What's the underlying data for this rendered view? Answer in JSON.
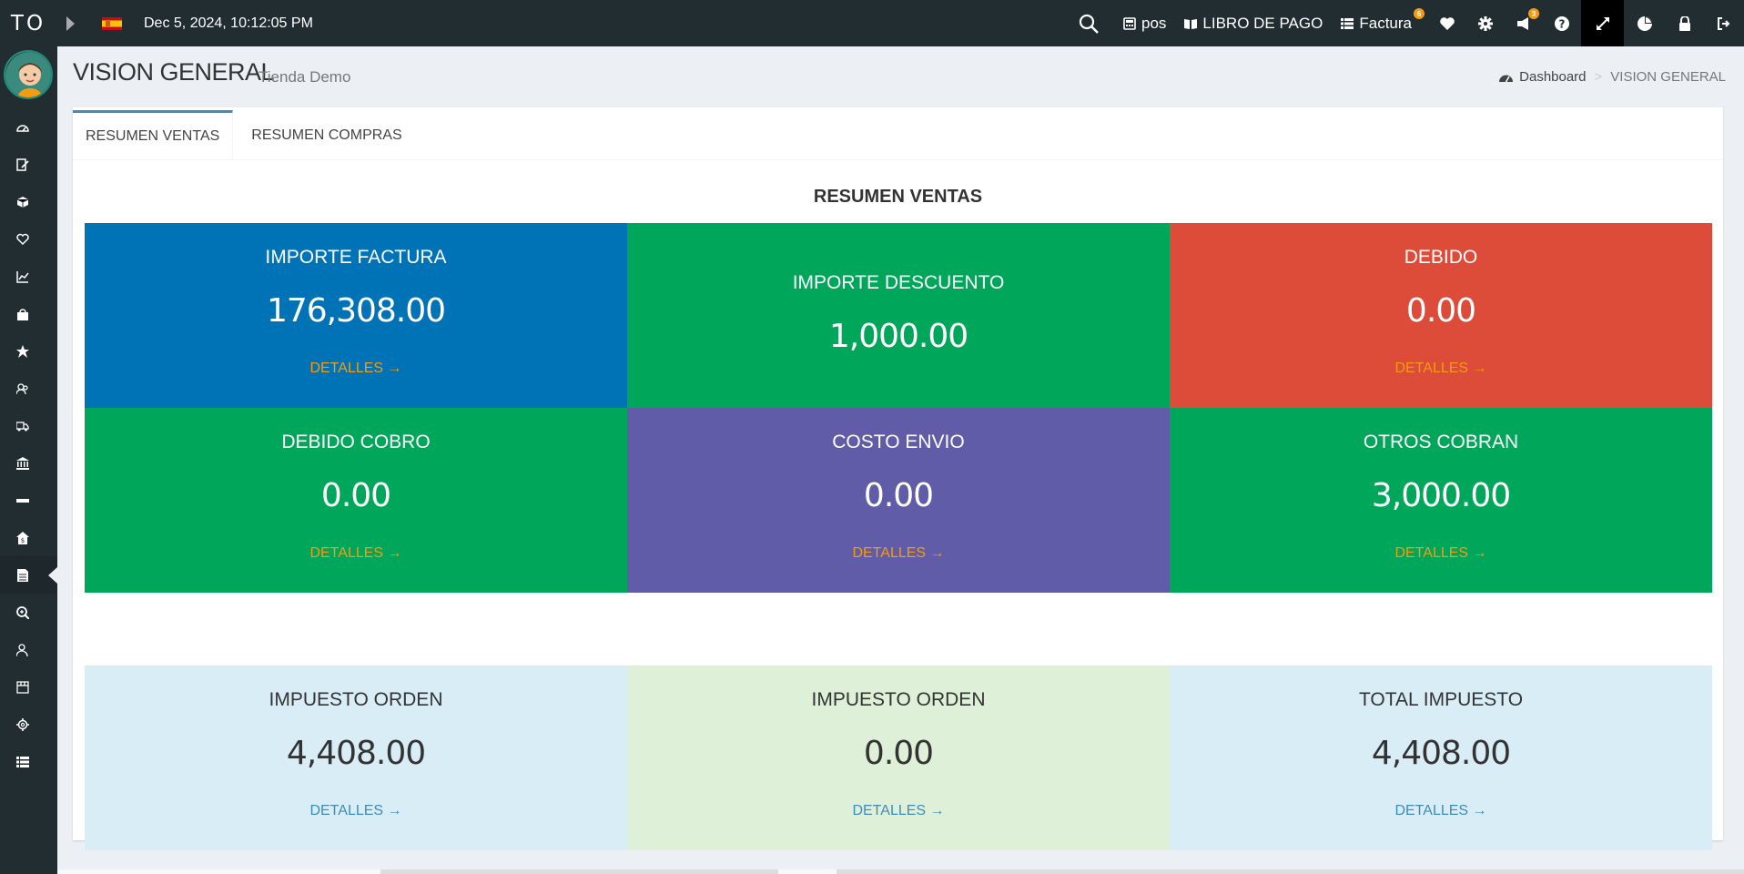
{
  "topbar": {
    "logo": "TO",
    "datetime": "Dec 5, 2024, 10:12:05 PM",
    "pos_label": "pos",
    "libro_label": "LIBRO DE PAGO",
    "factura_label": "Factura",
    "factura_badge": "6",
    "notif_badge": "3",
    "flag_color": "#c60b1e"
  },
  "sidebar": {
    "icons": [
      "dashboard-icon",
      "edit-icon",
      "cube-icon",
      "heart-icon",
      "chart-line-icon",
      "shopping-bag-icon",
      "star-icon",
      "group-icon",
      "truck-icon",
      "bank-icon",
      "minus-icon",
      "home-money-icon",
      "file-text-icon",
      "search-plus-icon",
      "user-icon",
      "tag-icon",
      "gear-icon",
      "list-icon"
    ],
    "active_index": 12
  },
  "header": {
    "title": "VISION GENERAL",
    "subtitle": "Tienda Demo",
    "breadcrumb_home": "Dashboard",
    "breadcrumb_sep": ">",
    "breadcrumb_current": "VISION GENERAL"
  },
  "tabs": [
    {
      "label": "RESUMEN VENTAS"
    },
    {
      "label": "RESUMEN COMPRAS"
    }
  ],
  "section_title": "RESUMEN VENTAS",
  "boxes": [
    {
      "title": "IMPORTE FACTURA",
      "value": "176,308.00",
      "details": "DETALLES →",
      "color": "#0073b7"
    },
    {
      "title": "IMPORTE DESCUENTO",
      "value": "1,000.00",
      "details": "",
      "color": "#00a65a"
    },
    {
      "title": "DEBIDO",
      "value": "0.00",
      "details": "DETALLES →",
      "color": "#dd4b39"
    },
    {
      "title": "DEBIDO COBRO",
      "value": "0.00",
      "details": "DETALLES →",
      "color": "#00a65a"
    },
    {
      "title": "COSTO ENVIO",
      "value": "0.00",
      "details": "DETALLES →",
      "color": "#605ca8"
    },
    {
      "title": "OTROS COBRAN",
      "value": "3,000.00",
      "details": "DETALLES →",
      "color": "#00a65a"
    }
  ],
  "tax_boxes": [
    {
      "title": "IMPUESTO ORDEN",
      "value": "4,408.00",
      "details": "DETALLES →",
      "color": "#d9edf7"
    },
    {
      "title": "IMPUESTO ORDEN",
      "value": "0.00",
      "details": "DETALLES →",
      "color": "#dff0d8"
    },
    {
      "title": "TOTAL IMPUESTO",
      "value": "4,408.00",
      "details": "DETALLES →",
      "color": "#d9edf7"
    }
  ]
}
